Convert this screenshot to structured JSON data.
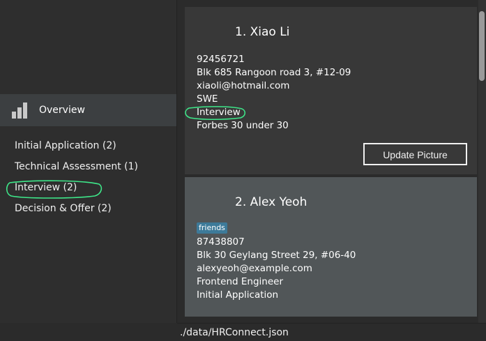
{
  "sidebar": {
    "overview_label": "Overview",
    "overview_icon": "bar-chart-icon",
    "stages": [
      "Initial Application (2)",
      "Technical Assessment (1)",
      "Interview (2)",
      "Decision & Offer (2)"
    ]
  },
  "persons": [
    {
      "title": "1.  Xiao Li",
      "phone": "92456721",
      "address": "Blk 685 Rangoon road 3, #12-09",
      "email": "xiaoli@hotmail.com",
      "role": "SWE",
      "stage": "Interview",
      "note": "Forbes 30 under 30",
      "button": "Update Picture"
    },
    {
      "title": "2.  Alex Yeoh",
      "tag": "friends",
      "phone": "87438807",
      "address": "Blk 30 Geylang Street 29, #06-40",
      "email": "alexyeoh@example.com",
      "role": "Frontend Engineer",
      "stage": "Initial Application"
    }
  ],
  "status": {
    "path": "./data/HRConnect.json"
  },
  "colors": {
    "annotation": "#3ee88a",
    "tag": "#3d7a99",
    "sidebar_selected": "#3c3f41"
  }
}
